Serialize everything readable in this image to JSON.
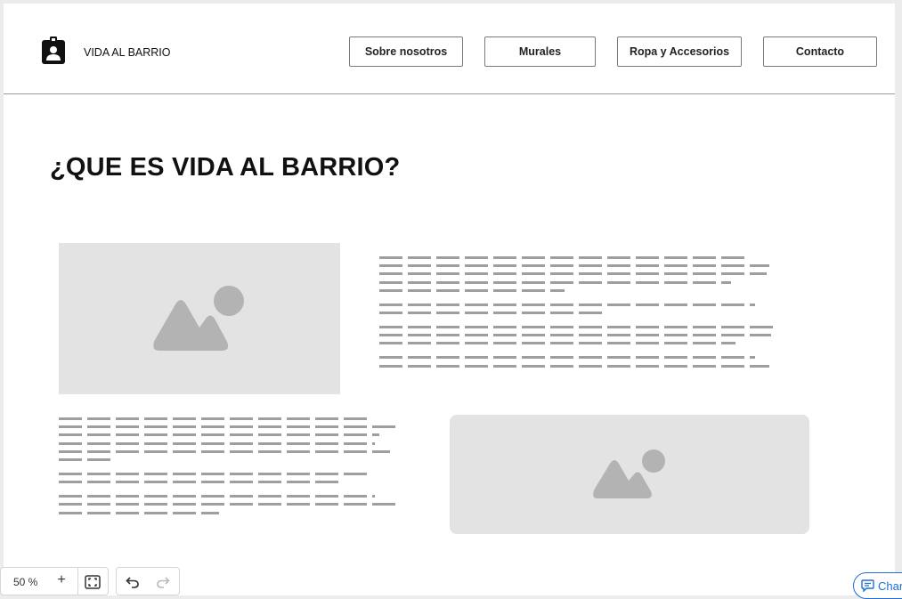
{
  "header": {
    "brand": "VIDA AL BARRIO",
    "logo_icon": "badge-person-icon",
    "nav": [
      {
        "label": "Sobre nosotros"
      },
      {
        "label": "Murales"
      },
      {
        "label": "Ropa y Accesorios"
      },
      {
        "label": "Contacto"
      }
    ]
  },
  "main": {
    "title": "¿QUE ES VIDA AL BARRIO?",
    "image_placeholder_icon": "image-placeholder-icon"
  },
  "toolbar": {
    "zoom_label": "50 %",
    "zoom_in_label": "+",
    "fit_icon": "fit-screen-icon",
    "undo_icon": "undo-icon",
    "redo_icon": "redo-icon"
  },
  "chat": {
    "label": "Char",
    "icon": "chat-bubble-icon",
    "color": "#1e6fd9"
  }
}
